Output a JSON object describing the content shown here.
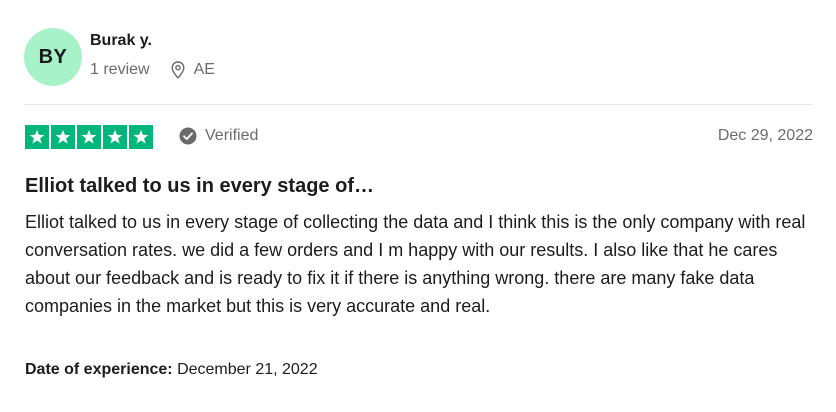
{
  "reviewer": {
    "initials": "BY",
    "avatar_color": "#a7f2c8",
    "name": "Burak y.",
    "review_count": "1 review",
    "location": "AE",
    "location_icon": "location-pin-icon"
  },
  "rating": {
    "stars": 5,
    "max_stars": 5,
    "star_color": "#00b67a",
    "verified_label": "Verified",
    "verified_icon": "check-circle-icon",
    "date": "Dec 29, 2022"
  },
  "review": {
    "title": "Elliot talked to us in every stage of…",
    "body": "Elliot talked to us in every stage of collecting the data and I think this is the only company with real conversation rates. we did a few orders and I m happy with our results. I also like that he cares about our feedback and is ready to fix it if there is anything wrong. there are many fake data companies in the market but this is very accurate and real.",
    "experience_label": "Date of experience:",
    "experience_date": "December 21, 2022"
  }
}
